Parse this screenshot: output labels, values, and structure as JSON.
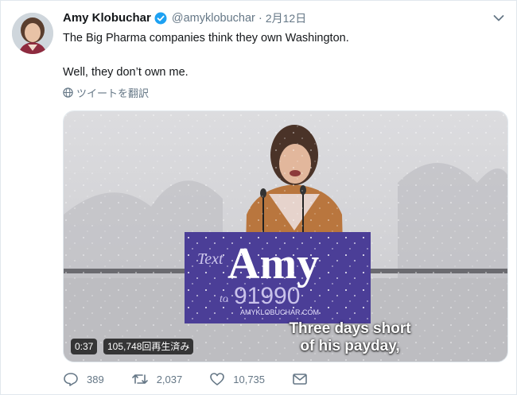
{
  "tweet": {
    "name": "Amy Klobuchar",
    "handle": "@amyklobuchar",
    "separator": "·",
    "date": "2月12日",
    "line1": "The Big Pharma companies think they own Washington.",
    "line2": "Well, they don’t own me.",
    "translate": "ツイートを翻訳"
  },
  "video": {
    "duration": "0:37",
    "views": "105,748回再生済み",
    "caption_line1": "Three days short",
    "caption_line2": "of his payday,",
    "sign_text_label": "Text",
    "sign_name": "Amy",
    "sign_to": "to",
    "sign_number": "91990",
    "sign_url": "AMYKLOBUCHAR.COM"
  },
  "actions": {
    "replies": "389",
    "retweets": "2,037",
    "likes": "10,735"
  },
  "colors": {
    "verified": "#1da1f2",
    "muted": "#657786",
    "sign_purple": "#4b3e97"
  }
}
